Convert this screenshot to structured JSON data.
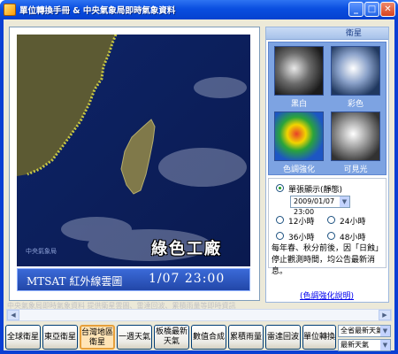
{
  "window": {
    "title": "單位轉換手冊 & 中央氣象局即時氣象資料",
    "minimize_glyph": "_",
    "maximize_glyph": "□",
    "close_glyph": "✕"
  },
  "satellite": {
    "watermark": "中央氣象局",
    "logo_text": "綠色工廠",
    "caption_label": "MTSAT 紅外線雲圖",
    "caption_time": "1/07  23:00"
  },
  "side_panel": {
    "header": "衛星",
    "thumbnails": [
      {
        "label": "黑白",
        "icon": "satellite-thumbnail"
      },
      {
        "label": "彩色",
        "icon": "satellite-thumbnail"
      },
      {
        "label": "色調強化",
        "icon": "satellite-thumbnail"
      },
      {
        "label": "可見光",
        "icon": "satellite-thumbnail"
      }
    ],
    "single_display_label": "單張顯示(靜態)",
    "time_value": "2009/01/07 23:00",
    "intervals": [
      "12小時",
      "24小時",
      "36小時",
      "48小時"
    ],
    "notice": "每年春、秋分前後，因「日蝕」停止觀測時間，均公告最新消息。",
    "enhance_link": "(色調強化說明)"
  },
  "marquee_text": "中央氣象局即時氣象資料 提供衛星雲圖、雷達回波、累積雨量等即時資訊",
  "toolbar": {
    "buttons": [
      {
        "label": "全球衛星"
      },
      {
        "label": "東亞衛星"
      },
      {
        "label": "台灣地區衛星"
      },
      {
        "label": "一週天氣"
      },
      {
        "label": "板橋最新天氣"
      },
      {
        "label": "數值合成"
      },
      {
        "label": "累積雨量"
      },
      {
        "label": "雷達回波"
      },
      {
        "label": "單位轉換"
      }
    ],
    "region_select": "全省最新天氣",
    "item_select": "最新天氣"
  },
  "colors": {
    "title_bar": "#0a4ee0",
    "active_button": "#ffe4b6",
    "link": "#0000ee"
  }
}
